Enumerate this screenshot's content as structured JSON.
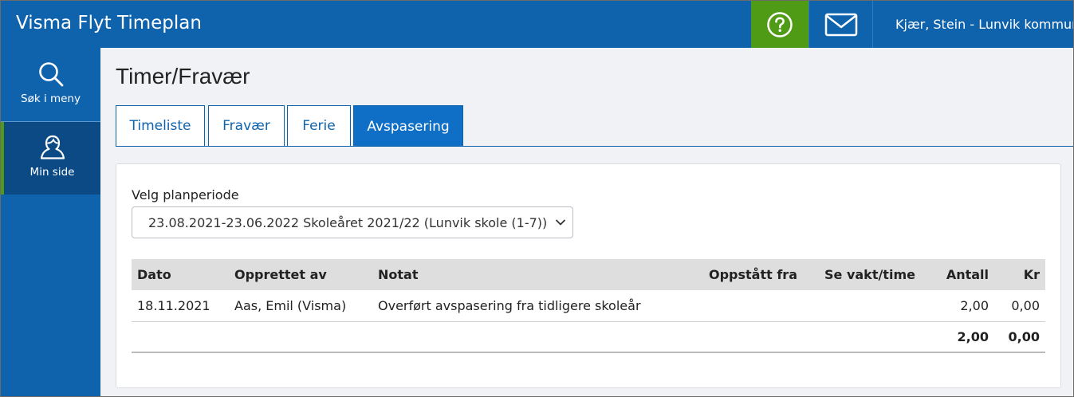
{
  "header": {
    "app_title": "Visma Flyt Timeplan",
    "help_icon": "question-circle-icon",
    "mail_icon": "envelope-icon",
    "user_icon": "user-avatar-icon",
    "user_name": "Kjær, Stein - Lunvik kommune",
    "colors": {
      "bar": "#0f63ad",
      "help": "#4f9b16"
    }
  },
  "sidebar": {
    "items": [
      {
        "label": "Søk i meny",
        "icon": "search-icon"
      },
      {
        "label": "Min side",
        "icon": "user-icon"
      }
    ]
  },
  "main": {
    "title": "Timer/Fravær",
    "tabs": [
      {
        "label": "Timeliste",
        "active": false
      },
      {
        "label": "Fravær",
        "active": false
      },
      {
        "label": "Ferie",
        "active": false
      },
      {
        "label": "Avspasering",
        "active": true
      }
    ],
    "period": {
      "label": "Velg planperiode",
      "selected": "23.08.2021-23.06.2022 Skoleåret 2021/22 (Lunvik skole (1-7))"
    },
    "table": {
      "headers": {
        "dato": "Dato",
        "opprettet_av": "Opprettet av",
        "notat": "Notat",
        "oppstatt_fra": "Oppstått fra",
        "se_vakt": "Se vakt/time",
        "antall": "Antall",
        "kr": "Kr"
      },
      "rows": [
        {
          "dato": "18.11.2021",
          "opprettet_av": "Aas, Emil (Visma)",
          "notat": "Overført avspasering fra tidligere skoleår",
          "oppstatt_fra": "",
          "se_vakt": "",
          "antall": "2,00",
          "kr": "0,00"
        }
      ],
      "totals": {
        "antall": "2,00",
        "kr": "0,00"
      }
    }
  }
}
